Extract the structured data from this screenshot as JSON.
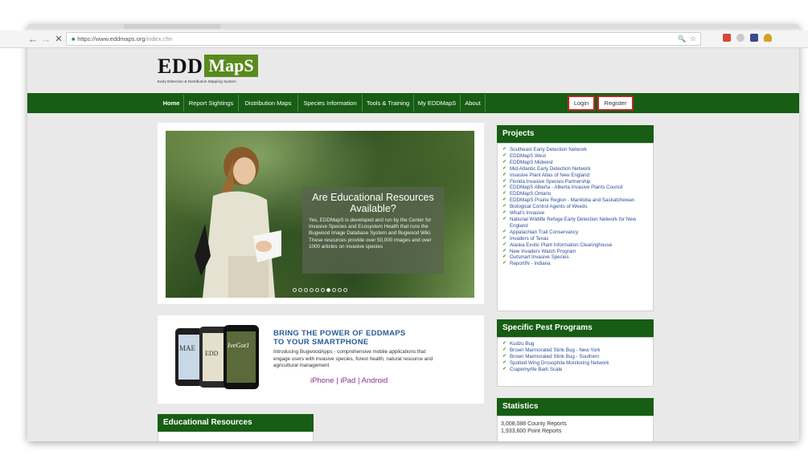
{
  "browser": {
    "url_base": "https://www.eddmaps.org",
    "url_path": "/index.cfm",
    "back_glyph": "←",
    "forward_glyph": "→",
    "reload_glyph": "✕",
    "zoom_glyph": "🔍",
    "star_glyph": "☆"
  },
  "logo": {
    "edd": "EDD",
    "maps": "MapS",
    "tagline": "Early Detection & Distribution Mapping System"
  },
  "nav": {
    "items": [
      "Home",
      "Report Sightings",
      "Distribution Maps",
      "Species Information",
      "Tools & Training",
      "My EDDMapS",
      "About"
    ],
    "login": "Login",
    "register": "Register"
  },
  "slider": {
    "title": "Are Educational Resources Available?",
    "body": "Yes, EDDMapS is developed and run by the Center for Invasive Species and Ecosystem Health that runs the Bugwood Image Database System and Bugwood Wiki. These resources provide over 50,000 images and over 1000 articles on invasive species",
    "dots_total": 10,
    "dots_active_index": 6
  },
  "promo": {
    "title_line1": "BRING THE POWER OF EDDMAPS",
    "title_line2": "TO YOUR SMARTPHONE",
    "description": "Introducing BugwoodApps - comprehensive mobile applications that engage users with invasive species, forest health, natural resource and agricultural management",
    "platforms": "iPhone | iPad | Android",
    "phone_labels": [
      "MAE",
      "EDD",
      "IveGot1"
    ]
  },
  "projects": {
    "title": "Projects",
    "items": [
      "Southeast Early Detection Network",
      "EDDMapS West",
      "EDDMapS Midwest",
      "Mid-Atlantic Early Detection Network",
      "Invasive Plant Atlas of New England",
      "Florida Invasive Species Partnership",
      "EDDMapS Alberta - Alberta Invasive Plants Council",
      "EDDMapS Ontario",
      "EDDMapS Prairie Region - Manitoba and Saskatchewan",
      "Biological Control Agents of Weeds",
      "What's Invasive",
      "National Wildlife Refuge Early Detection Network for New England",
      "Appalachian Trail Conservancy",
      "Invaders of Texas",
      "Alaska Exotic Plant Information Clearinghouse",
      "New Invaders Watch Program",
      "Outsmart Invasive Species",
      "ReportIN - Indiana"
    ]
  },
  "pests": {
    "title": "Specific Pest Programs",
    "items": [
      "Kudzu Bug",
      "Brown Marmorated Stink Bug - New York",
      "Brown Marmorated Stink Bug - Southern",
      "Spotted Wing Drosophila Monitoring Network",
      "Crapemyrtle Bark Scale"
    ]
  },
  "statistics": {
    "title": "Statistics",
    "lines": [
      "3,008,088 County Reports",
      "1,933,600 Point Reports"
    ]
  },
  "educational": {
    "title": "Educational Resources"
  },
  "colors": {
    "nav_green": "#175d14",
    "logo_green": "#5a8a1f",
    "highlight_red": "#c02525",
    "link_blue": "#2a4f9a",
    "platform_purple": "#8c2e8f"
  }
}
